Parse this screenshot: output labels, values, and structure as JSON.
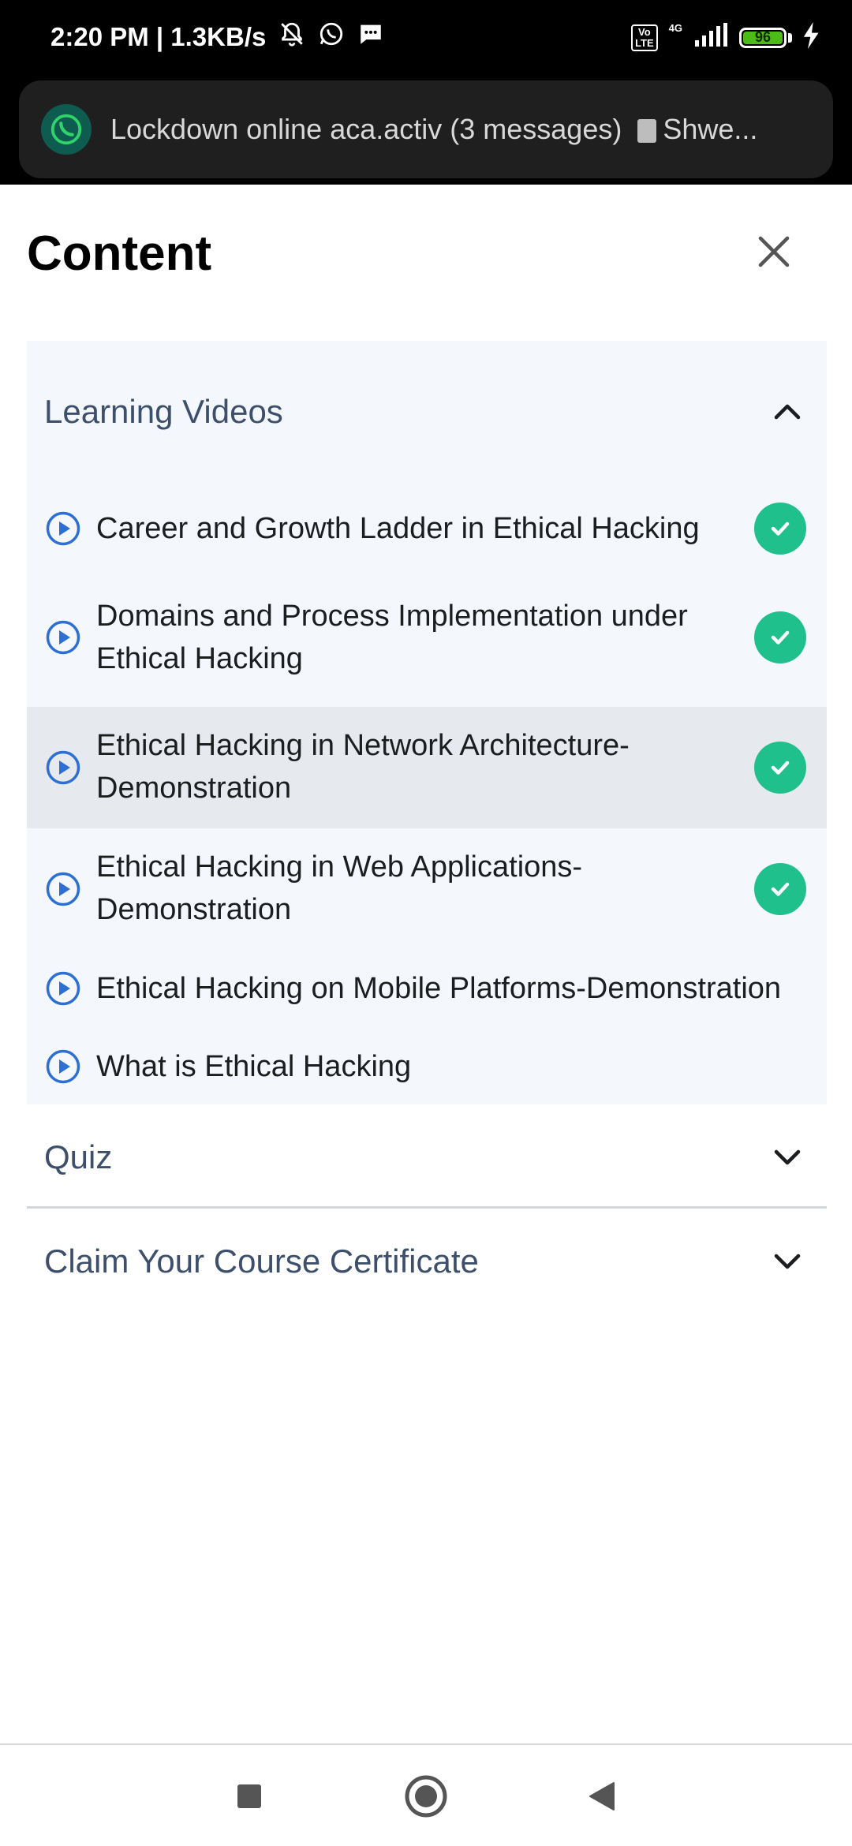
{
  "status": {
    "time_speed": "2:20 PM | 1.3KB/s",
    "volte": "Vo\nLTE",
    "network": "4G",
    "battery_percent": 96,
    "battery_text": "96"
  },
  "notification": {
    "text": "Lockdown online aca.activ (3 messages)",
    "attachment": "Shwe..."
  },
  "header": {
    "title": "Content"
  },
  "sections": {
    "learning_videos": {
      "title": "Learning Videos",
      "items": [
        {
          "label": "Career and Growth Ladder in Ethical Hacking",
          "completed": true
        },
        {
          "label": "Domains and Process Implementation under Ethical Hacking",
          "completed": true
        },
        {
          "label": "Ethical Hacking in Network Architecture-Demonstration",
          "completed": true
        },
        {
          "label": "Ethical Hacking in Web Applications-Demonstration",
          "completed": true
        },
        {
          "label": "Ethical Hacking on Mobile Platforms-Demonstration",
          "completed": false
        },
        {
          "label": "What is Ethical Hacking",
          "completed": false
        }
      ]
    },
    "quiz": {
      "title": "Quiz"
    },
    "certificate": {
      "title": "Claim Your Course Certificate"
    }
  },
  "colors": {
    "accent_blue": "#2d6fd2",
    "completed_green": "#1fc08b",
    "section_bg": "#f4f8fd",
    "section_text": "#3d4f6b"
  }
}
